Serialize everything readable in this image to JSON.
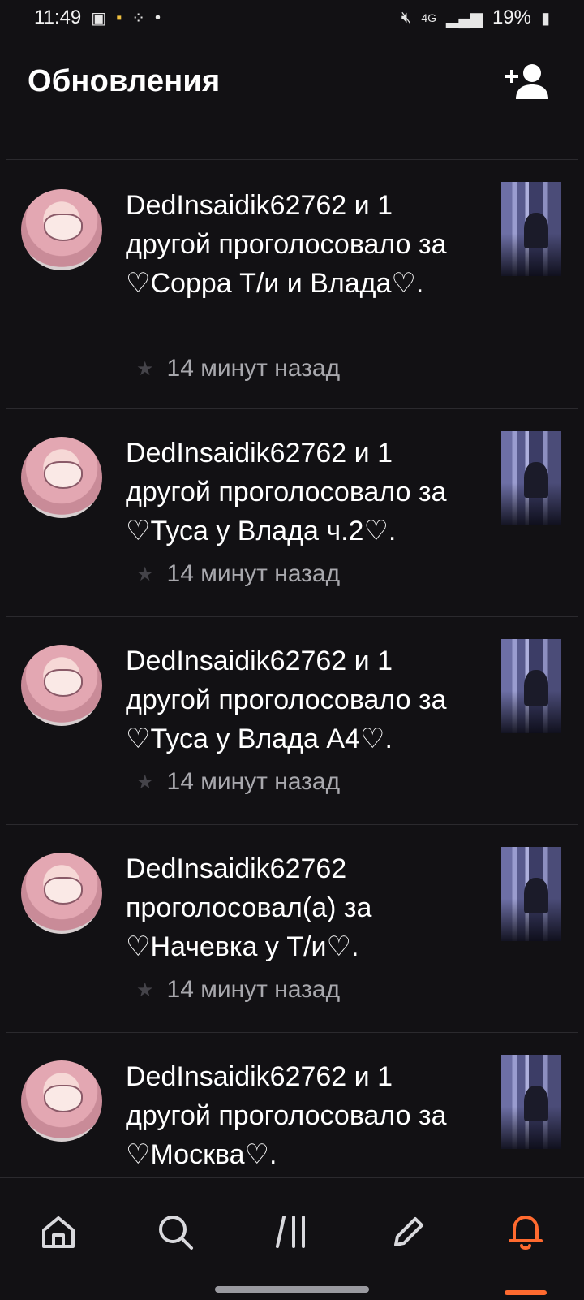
{
  "status_bar": {
    "time": "11:49",
    "battery": "19%",
    "network": "4G",
    "icons": [
      "image-icon",
      "app-icon",
      "grid-icon",
      "dot-icon",
      "mute-icon",
      "signal-icon",
      "battery-icon"
    ]
  },
  "header": {
    "title": "Обновления",
    "add_user_icon": "add-user-icon"
  },
  "feed": {
    "items": [
      {
        "text": "DedInsaidik62762 и 1 другой проголосовало за ♡Сорра Т/и и Влада♡.",
        "time": "14 минут назад"
      },
      {
        "text": "DedInsaidik62762 и 1 другой проголосовало за ♡Туса у Влада ч.2♡.",
        "time": "14 минут назад"
      },
      {
        "text": "DedInsaidik62762 и 1 другой проголосовало за ♡Туса у Влада А4♡.",
        "time": "14 минут назад"
      },
      {
        "text": "DedInsaidik62762 проголосовал(а) за ♡Начевка у Т/и♡.",
        "time": "14 минут назад"
      },
      {
        "text": "DedInsaidik62762 и 1 другой проголосовало за ♡Москва♡.",
        "time": ""
      }
    ]
  },
  "bottom_nav": {
    "tabs": [
      "home-icon",
      "search-icon",
      "library-icon",
      "pencil-icon",
      "bell-icon"
    ],
    "active_tab": "bell-icon",
    "colors": {
      "inactive": "#d9d9dd",
      "active": "#ff6a2f"
    }
  }
}
